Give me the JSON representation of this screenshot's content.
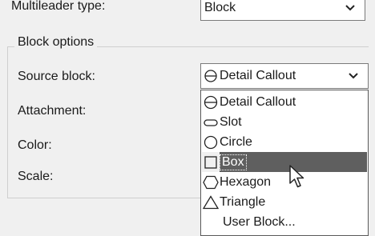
{
  "top_row": {
    "label": "Multileader type:",
    "value": "Block",
    "chevron": "chevron-down-icon"
  },
  "block_options": {
    "title": "Block options",
    "source_block_label": "Source block:",
    "source_block_value": "Detail Callout",
    "attachment_label": "Attachment:",
    "color_label": "Color:",
    "scale_label": "Scale:"
  },
  "dropdown": {
    "options": [
      {
        "label": "Detail Callout",
        "icon": "detail-callout-icon"
      },
      {
        "label": "Slot",
        "icon": "slot-icon"
      },
      {
        "label": "Circle",
        "icon": "circle-icon"
      },
      {
        "label": "Box",
        "icon": "box-icon",
        "selected": true
      },
      {
        "label": "Hexagon",
        "icon": "hexagon-icon"
      },
      {
        "label": "Triangle",
        "icon": "triangle-icon"
      },
      {
        "label": "User Block...",
        "icon": ""
      }
    ]
  },
  "colors": {
    "highlight": "#5f5f5f",
    "panel": "#f0f0f0"
  }
}
